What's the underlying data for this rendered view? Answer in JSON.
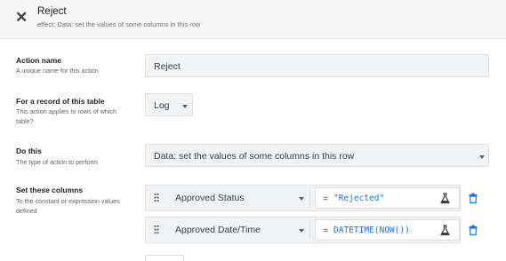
{
  "header": {
    "title": "Reject",
    "subtitle": "effect: Data: set the values of some columns in this row"
  },
  "action_name": {
    "label": "Action name",
    "hint": "A unique name for this action",
    "value": "Reject"
  },
  "record_table": {
    "label": "For a record of this table",
    "hint": "This action applies to rows of which table?",
    "value": "Log"
  },
  "do_this": {
    "label": "Do this",
    "hint": "The type of action to perform",
    "value": "Data: set the values of some columns in this row"
  },
  "set_columns": {
    "label": "Set these columns",
    "hint": "To the constant or expression values defined",
    "rows": [
      {
        "column": "Approved Status",
        "operator": "=",
        "expression": "\"Rejected\""
      },
      {
        "column": "Approved Date/Time",
        "operator": "=",
        "expression": "DATETIME(NOW())"
      }
    ]
  },
  "icons": {
    "close": "close-icon",
    "flask": "flask-icon",
    "trash": "trash-icon",
    "drag": "drag-handle-icon",
    "dropdown": "chevron-down-icon"
  },
  "colors": {
    "accent": "#1a73e8",
    "header_bg": "#f5f5f5",
    "field_bg": "#f1f3f4"
  }
}
